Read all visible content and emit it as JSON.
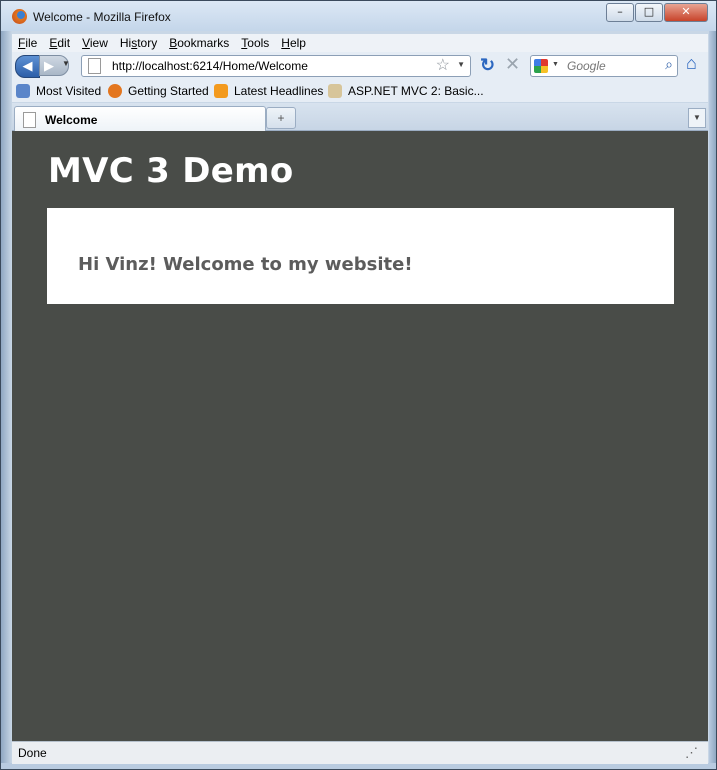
{
  "window": {
    "title": "Welcome - Mozilla Firefox",
    "controls": {
      "minimize": "–",
      "maximize": "□",
      "close": "✕"
    }
  },
  "menu": {
    "items": [
      {
        "label": "File",
        "accel": "F",
        "rest": "ile"
      },
      {
        "label": "Edit",
        "accel": "E",
        "rest": "dit"
      },
      {
        "label": "View",
        "accel": "V",
        "rest": "iew"
      },
      {
        "label": "History",
        "pre": "Hi",
        "accel": "s",
        "rest": "tory"
      },
      {
        "label": "Bookmarks",
        "accel": "B",
        "rest": "ookmarks"
      },
      {
        "label": "Tools",
        "accel": "T",
        "rest": "ools"
      },
      {
        "label": "Help",
        "accel": "H",
        "rest": "elp"
      }
    ]
  },
  "nav": {
    "url": "http://localhost:6214/Home/Welcome",
    "search_placeholder": "Google"
  },
  "bookmarks": {
    "items": [
      {
        "label": "Most Visited",
        "icon": "most-visited-icon",
        "color": "#5a85c9"
      },
      {
        "label": "Getting Started",
        "icon": "firefox-icon",
        "color": "#e3761f"
      },
      {
        "label": "Latest Headlines",
        "icon": "rss-icon",
        "color": "#f39a1e"
      },
      {
        "label": "ASP.NET MVC 2: Basic...",
        "icon": "aspnet-icon",
        "color": "#d7c59a"
      }
    ]
  },
  "tabs": {
    "active": "Welcome"
  },
  "page": {
    "site_title": "MVC 3 Demo",
    "welcome_message": "Hi Vinz! Welcome to my website!",
    "background": "#494c48"
  },
  "status": {
    "text": "Done"
  }
}
